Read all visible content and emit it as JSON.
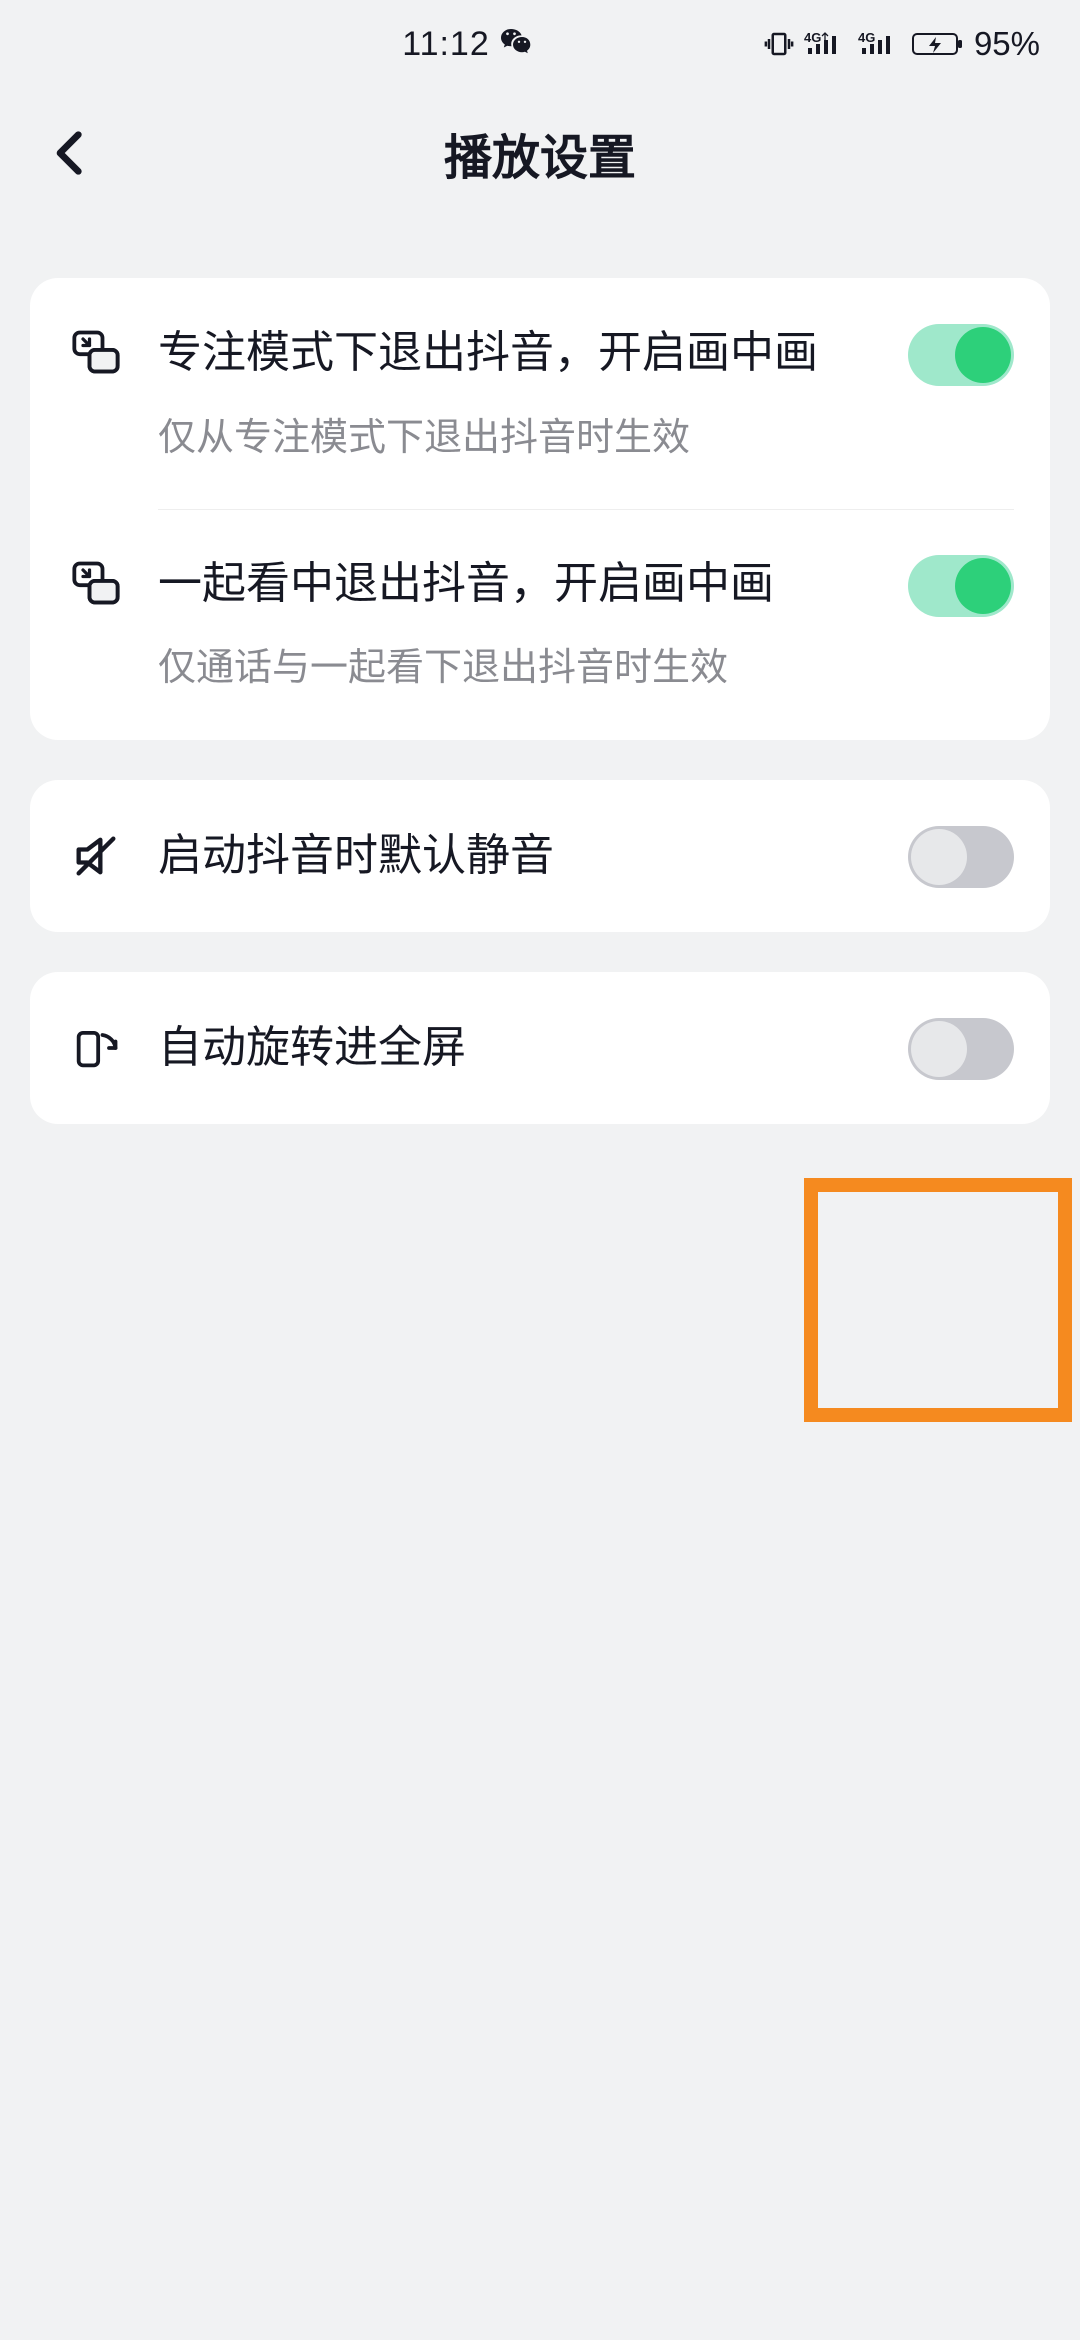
{
  "status": {
    "time": "11:12",
    "battery_pct": "95%"
  },
  "header": {
    "title": "播放设置"
  },
  "settings": {
    "pip_focus": {
      "title": "专注模式下退出抖音，开启画中画",
      "sub": "仅从专注模式下退出抖音时生效",
      "on": true
    },
    "pip_watch_together": {
      "title": "一起看中退出抖音，开启画中画",
      "sub": "仅通话与一起看下退出抖音时生效",
      "on": true
    },
    "mute_on_launch": {
      "title": "启动抖音时默认静音",
      "on": false
    },
    "auto_rotate_fullscreen": {
      "title": "自动旋转进全屏",
      "on": false
    }
  }
}
